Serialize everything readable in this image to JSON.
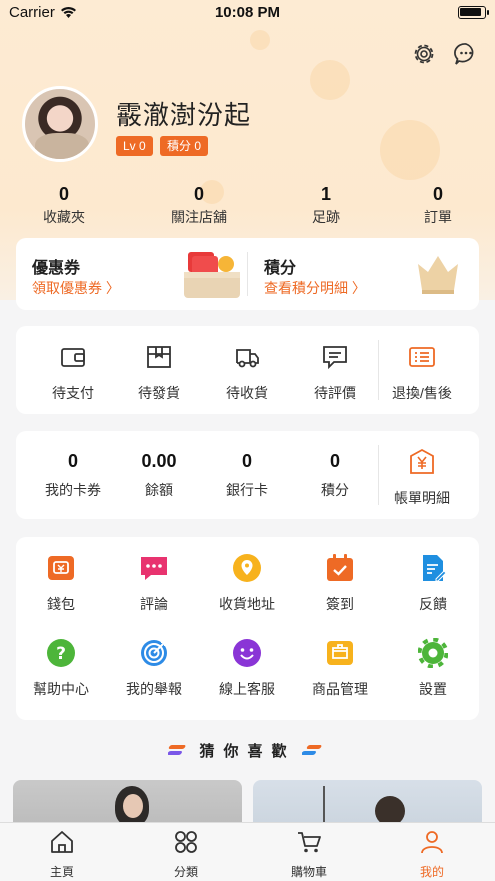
{
  "status_bar": {
    "carrier": "Carrier",
    "time": "10:08 PM"
  },
  "profile": {
    "name": "霰澈澍汾起",
    "level_badge": "Lv 0",
    "points_badge": "積分 0"
  },
  "stats": [
    {
      "value": "0",
      "label": "收藏夾"
    },
    {
      "value": "0",
      "label": "關注店舖"
    },
    {
      "value": "1",
      "label": "足跡"
    },
    {
      "value": "0",
      "label": "訂單"
    }
  ],
  "promo": {
    "coupon_title": "優惠券",
    "coupon_link": "領取優惠券 〉",
    "points_title": "積分",
    "points_link": "查看積分明細 〉"
  },
  "orders": [
    {
      "icon": "wallet-icon",
      "label": "待支付"
    },
    {
      "icon": "box-icon",
      "label": "待發貨"
    },
    {
      "icon": "truck-icon",
      "label": "待收貨"
    },
    {
      "icon": "comment-icon",
      "label": "待評價"
    },
    {
      "icon": "refund-list-icon",
      "label": "退換/售後"
    }
  ],
  "assets": [
    {
      "value": "0",
      "label": "我的卡券"
    },
    {
      "value": "0.00",
      "label": "餘額"
    },
    {
      "value": "0",
      "label": "銀行卡"
    },
    {
      "value": "0",
      "label": "積分"
    },
    {
      "icon": "bill-icon",
      "label": "帳單明細"
    }
  ],
  "services": [
    {
      "icon": "wallet-icon",
      "label": "錢包"
    },
    {
      "icon": "review-icon",
      "label": "評論"
    },
    {
      "icon": "location-icon",
      "label": "收貨地址"
    },
    {
      "icon": "calendar-check-icon",
      "label": "簽到"
    },
    {
      "icon": "feedback-icon",
      "label": "反饋"
    },
    {
      "icon": "help-icon",
      "label": "幫助中心"
    },
    {
      "icon": "target-icon",
      "label": "我的舉報"
    },
    {
      "icon": "smile-icon",
      "label": "線上客服"
    },
    {
      "icon": "goods-icon",
      "label": "商品管理"
    },
    {
      "icon": "gear-icon",
      "label": "設置"
    }
  ],
  "recommend_title": "猜你喜歡",
  "tabs": [
    {
      "icon": "home-icon",
      "label": "主頁"
    },
    {
      "icon": "category-icon",
      "label": "分類"
    },
    {
      "icon": "cart-icon",
      "label": "購物車"
    },
    {
      "icon": "user-icon",
      "label": "我的",
      "active": true
    }
  ],
  "colors": {
    "accent": "#ee6a25",
    "hero_bg": "#fdebd3"
  }
}
